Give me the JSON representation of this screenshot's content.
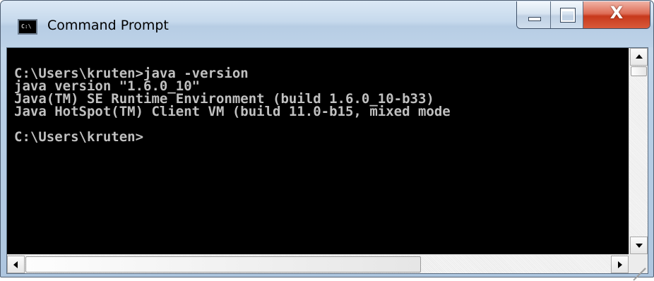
{
  "window": {
    "title": "Command Prompt",
    "app_icon_text": "C:\\",
    "buttons": {
      "minimize": "minimize",
      "maximize": "maximize",
      "close": "X"
    },
    "colors": {
      "console_bg": "#000000",
      "console_fg": "#c0c0c0",
      "close_button": "#c7391c"
    }
  },
  "console": {
    "lines": [
      "C:\\Users\\kruten>java -version",
      "java version \"1.6.0_10\"",
      "Java(TM) SE Runtime Environment (build 1.6.0_10-b33)",
      "Java HotSpot(TM) Client VM (build 11.0-b15, mixed mode",
      "",
      "C:\\Users\\kruten>"
    ]
  },
  "scrollbars": {
    "vertical": {
      "up_icon": "arrow-up-icon",
      "down_icon": "arrow-down-icon"
    },
    "horizontal": {
      "left_icon": "arrow-left-icon",
      "right_icon": "arrow-right-icon"
    }
  }
}
